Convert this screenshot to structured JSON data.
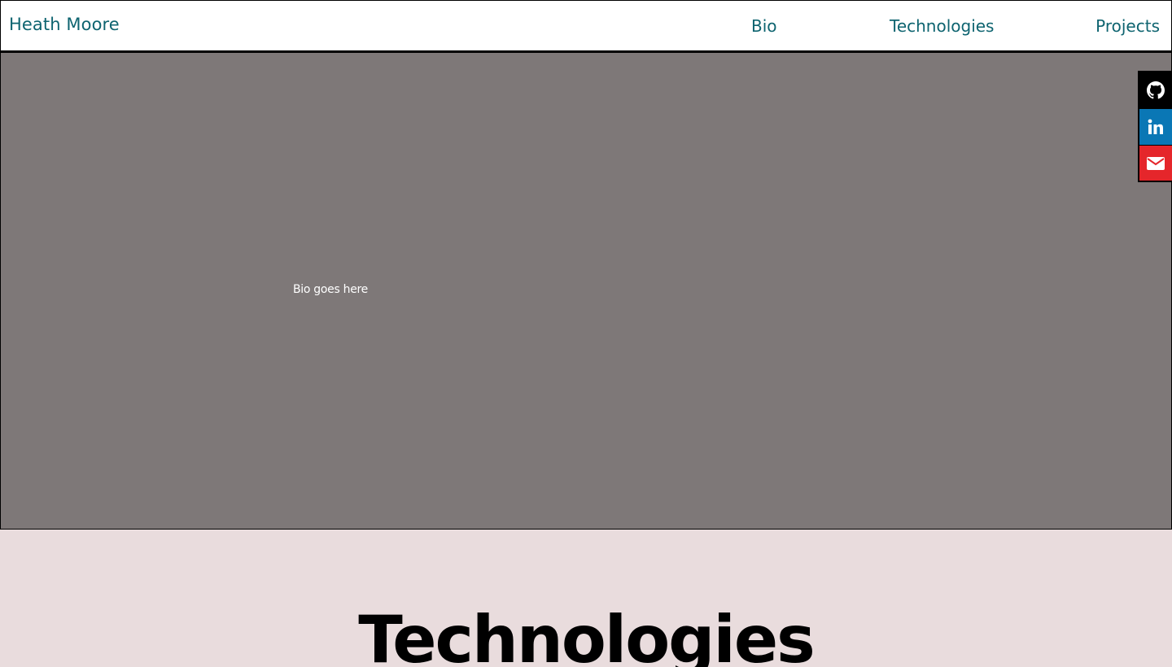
{
  "header": {
    "brand": "Heath Moore",
    "nav": {
      "bio": "Bio",
      "technologies": "Technologies",
      "projects": "Projects"
    }
  },
  "bio": {
    "text": "Bio goes here"
  },
  "social": {
    "items": [
      {
        "icon": "github-icon",
        "color": "#000000"
      },
      {
        "icon": "linkedin-icon",
        "color": "#0a77b5"
      },
      {
        "icon": "email-icon",
        "color": "#e5262b"
      }
    ]
  },
  "technologies": {
    "heading": "Technologies"
  },
  "colors": {
    "accent": "#0e6470",
    "bio_background": "#7e7878",
    "page_background": "#e9dcdd"
  }
}
